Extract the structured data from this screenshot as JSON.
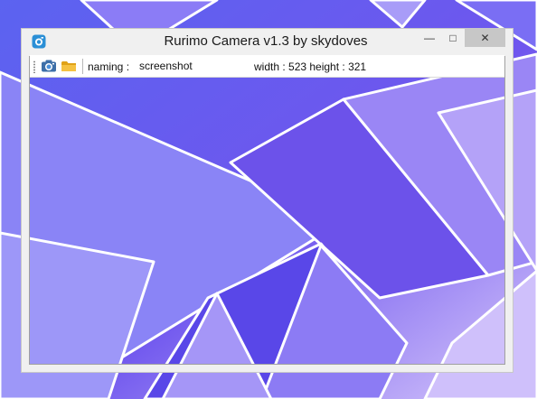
{
  "window": {
    "title": "Rurimo Camera v1.3 by skydoves",
    "minimize_glyph": "—",
    "maximize_glyph": "□",
    "close_glyph": "✕"
  },
  "toolbar": {
    "naming_label": "naming :",
    "naming_value": "screenshot",
    "dimensions_text": "width : 523 height : 321"
  },
  "icons": {
    "app": "camera-app-icon",
    "capture": "camera-icon",
    "open_folder": "folder-icon"
  },
  "colors": {
    "accent_blue": "#2b8fd6",
    "folder_yellow": "#f2b72e",
    "desktop_purple": "#6b5cf2"
  }
}
